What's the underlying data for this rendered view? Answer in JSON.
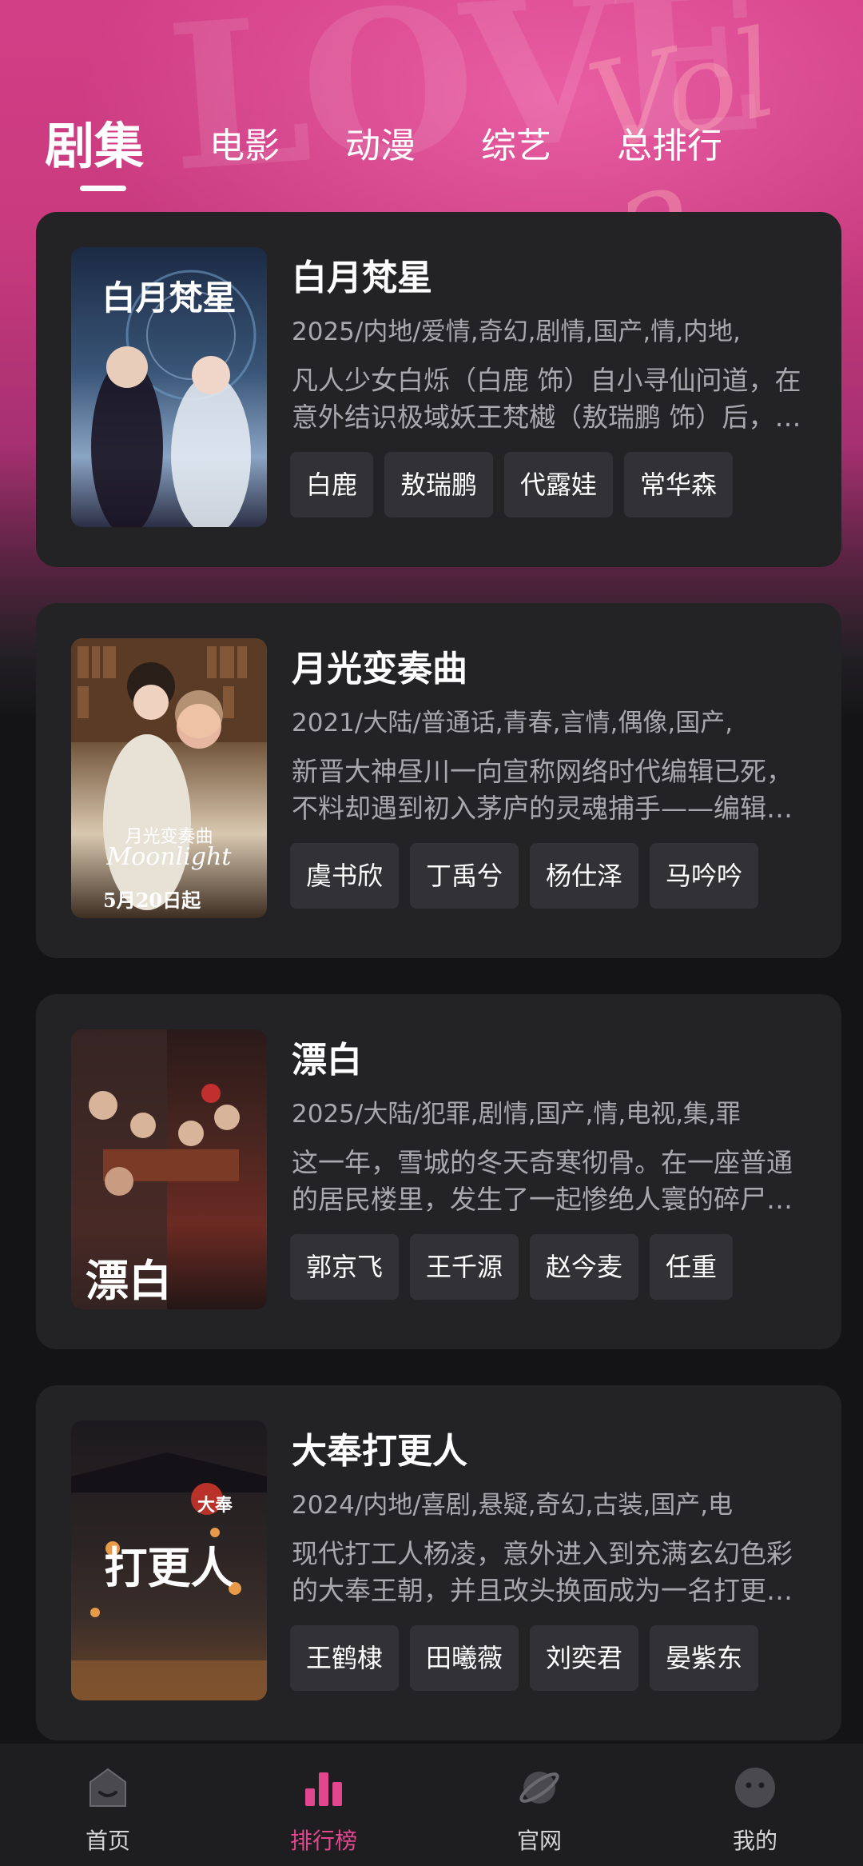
{
  "tabs": [
    {
      "label": "剧集",
      "active": true
    },
    {
      "label": "电影",
      "active": false
    },
    {
      "label": "动漫",
      "active": false
    },
    {
      "label": "综艺",
      "active": false
    },
    {
      "label": "总排行",
      "active": false
    }
  ],
  "background_deco": {
    "letters": "LOVE",
    "vol": "Vol 2"
  },
  "cards": [
    {
      "title": "白月梵星",
      "meta": "2025/内地/爱情,奇幻,剧情,国产,情,内地,",
      "desc": "        凡人少女白烁（白鹿 饰）自小寻仙问道，在意外结识极域妖王梵樾（敖瑞鹏 饰）后，与其结伴同行，共同经历了一场奇幻之旅。",
      "cast": [
        "白鹿",
        "敖瑞鹏",
        "代露娃",
        "常华森"
      ],
      "poster_text": "白月梵星",
      "poster_colors": [
        "#1b2a44",
        "#3a5678",
        "#8aa4c4"
      ]
    },
    {
      "title": "月光变奏曲",
      "meta": "2021/大陆/普通话,青春,言情,偶像,国产,",
      "desc": "新晋大神昼川一向宣称网络时代编辑已死，不料却遇到初入茅庐的灵魂捕手——编辑邹小姐，两人由此展开了一段欢喜冤家的故事。",
      "cast": [
        "虞书欣",
        "丁禹兮",
        "杨仕泽",
        "马吟吟"
      ],
      "poster_text": "月光变奏曲",
      "poster_subtext": "Moonlight",
      "poster_date": "5月20日起",
      "poster_colors": [
        "#4a3422",
        "#8a6a4a",
        "#d9c8b0"
      ]
    },
    {
      "title": "漂白",
      "meta": "2025/大陆/犯罪,剧情,国产,情,电视,集,罪",
      "desc": "        这一年，雪城的冬天奇寒彻骨。在一座普通的居民楼里，发生了一起惨绝人寰的碎尸案，刑警队长郑北随即展开调查。",
      "cast": [
        "郭京飞",
        "王千源",
        "赵今麦",
        "任重"
      ],
      "poster_text": "漂白",
      "poster_colors": [
        "#2a1a1a",
        "#6b2a22",
        "#b04a30"
      ]
    },
    {
      "title": "大奉打更人",
      "meta": "2024/内地/喜剧,悬疑,奇幻,古装,国产,电",
      "desc": "现代打工人杨凌，意外进入到充满玄幻色彩的大奉王朝，并且改头换面成为一名打更人，由此开启了一段奇妙的破案之旅。",
      "cast": [
        "王鹤棣",
        "田曦薇",
        "刘奕君",
        "晏紫东"
      ],
      "poster_text": "打更人",
      "poster_subtext": "大奉",
      "poster_colors": [
        "#1c1a1e",
        "#3a2e2a",
        "#c7783a"
      ]
    }
  ],
  "nav": [
    {
      "label": "首页",
      "icon": "home-icon",
      "active": false
    },
    {
      "label": "排行榜",
      "icon": "ranking-icon",
      "active": true
    },
    {
      "label": "官网",
      "icon": "planet-icon",
      "active": false
    },
    {
      "label": "我的",
      "icon": "profile-icon",
      "active": false
    }
  ],
  "colors": {
    "accent": "#e2468e",
    "card_bg": "#232326",
    "tag_bg": "#323236",
    "page_bg": "#141416"
  }
}
